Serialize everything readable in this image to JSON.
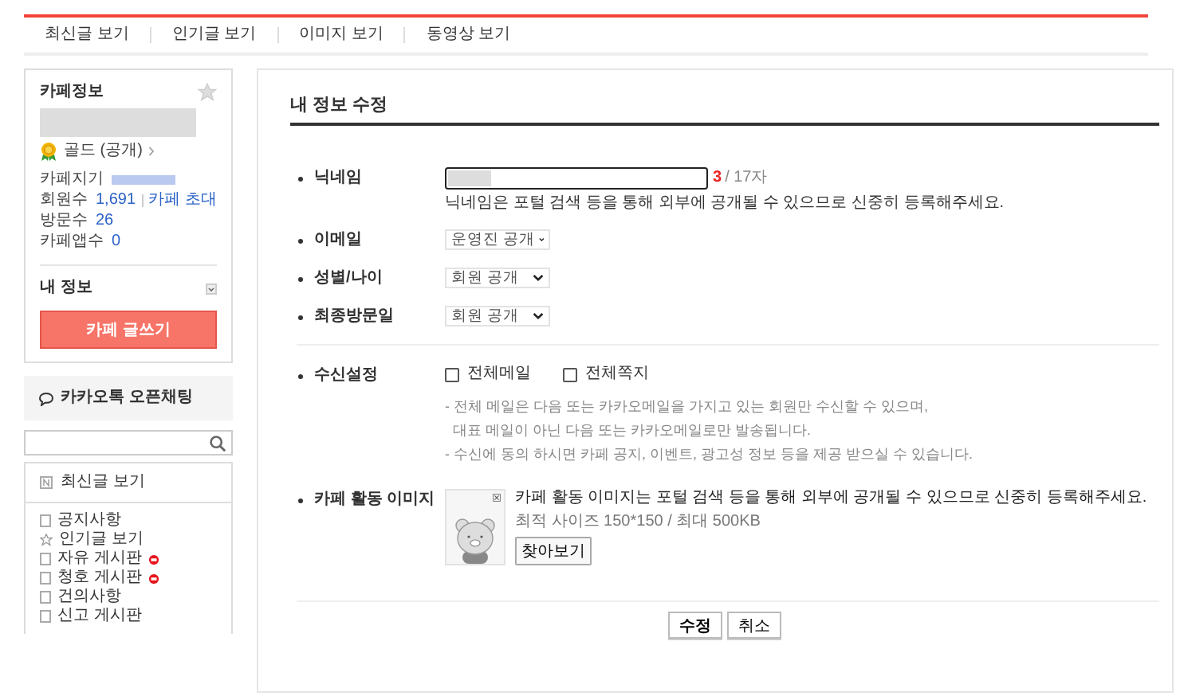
{
  "top_tabs": [
    {
      "label": "최신글 보기"
    },
    {
      "label": "인기글 보기"
    },
    {
      "label": "이미지 보기"
    },
    {
      "label": "동영상 보기"
    }
  ],
  "cafe_info": {
    "title": "카페정보",
    "favorite": false,
    "grade": "골드 (공개)",
    "stats": [
      {
        "kind": "bar",
        "label": "카페지기"
      },
      {
        "kind": "link",
        "label": "회원수",
        "value": "1,691",
        "link": "카페 초대"
      },
      {
        "kind": "value",
        "label": "방문수",
        "value": "26"
      },
      {
        "kind": "value",
        "label": "카페앱수",
        "value": "0"
      }
    ],
    "my_info": "내 정보",
    "write_button": "카페 글쓰기"
  },
  "open_chat": "카카오톡 오픈채팅",
  "menu": {
    "recent": "최신글 보기",
    "items": [
      {
        "kind": "board",
        "label": "공지사항",
        "new": false
      },
      {
        "kind": "star",
        "label": "인기글 보기",
        "new": false
      },
      {
        "kind": "board",
        "label": "자유 게시판",
        "new": true
      },
      {
        "kind": "board",
        "label": "청호 게시판",
        "new": true
      },
      {
        "kind": "board",
        "label": "건의사항",
        "new": false
      },
      {
        "kind": "board",
        "label": "신고 게시판",
        "new": false
      }
    ]
  },
  "form": {
    "title": "내 정보 수정",
    "nickname": {
      "label": "닉네임",
      "count": "3",
      "limit": "/ 17자",
      "hint": "닉네임은 포털 검색 등을 통해 외부에 공개될 수 있으므로 신중히 등록해주세요."
    },
    "selects": [
      {
        "label": "이메일",
        "value": "운영진 공개"
      },
      {
        "label": "성별/나이",
        "value": "회원 공개"
      },
      {
        "label": "최종방문일",
        "value": "회원 공개"
      }
    ],
    "receive": {
      "label": "수신설정",
      "options": [
        {
          "label": "전체메일",
          "checked": false
        },
        {
          "label": "전체쪽지",
          "checked": false
        }
      ],
      "notes": [
        "- 전체 메일은 다음 또는 카카오메일을 가지고 있는 회원만 수신할 수 있으며,",
        "대표 메일이 아닌 다음 또는 카카오메일로만 발송됩니다.",
        "- 수신에 동의 하시면 카페 공지, 이벤트, 광고성 정보 등을 제공 받으실 수 있습니다."
      ]
    },
    "image": {
      "label": "카페 활동 이미지",
      "notice": "카페 활동 이미지는 포털 검색 등을 통해 외부에 공개될 수 있으므로 신중히 등록해주세요.",
      "size": "최적 사이즈 150*150 / 최대 500KB",
      "browse": "찾아보기"
    },
    "buttons": [
      "수정",
      "취소"
    ]
  }
}
